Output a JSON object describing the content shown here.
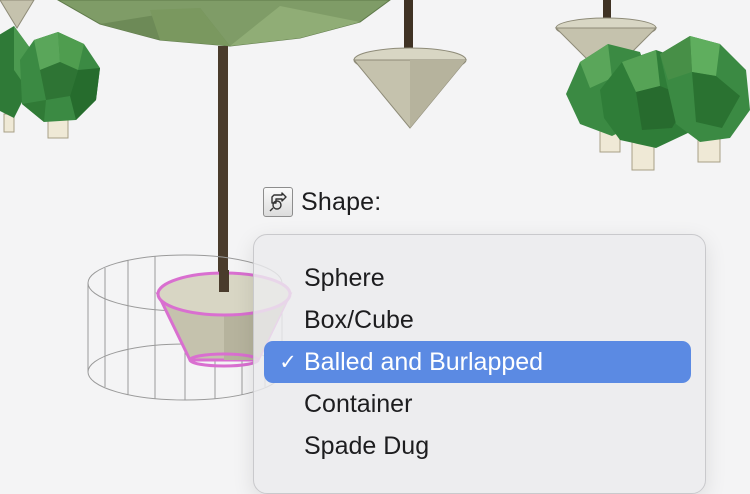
{
  "scene": {
    "background_color": "#f4f4f5",
    "foliage_color": "#3b8a43",
    "canopy_color": "#7f9c67",
    "rootball_color": "#c5c2ad",
    "selection_outline_color": "#d96fd0"
  },
  "shape_control": {
    "label": "Shape:",
    "icon": "shape-swap-icon"
  },
  "shape_menu": {
    "items": [
      {
        "label": "Sphere",
        "selected": false
      },
      {
        "label": "Box/Cube",
        "selected": false
      },
      {
        "label": "Balled and Burlapped",
        "selected": true
      },
      {
        "label": "Container",
        "selected": false
      },
      {
        "label": "Spade Dug",
        "selected": false
      }
    ],
    "checkmark": "✓",
    "highlight_color": "#5b8ae3"
  }
}
